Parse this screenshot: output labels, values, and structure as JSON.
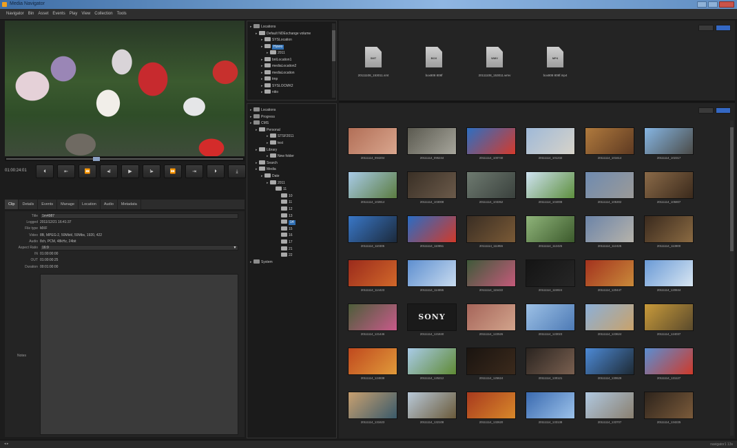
{
  "window": {
    "title": "Media Navigator"
  },
  "menu": [
    "Navigator",
    "Bin",
    "Asset",
    "Events",
    "Play",
    "View",
    "Collection",
    "Tools"
  ],
  "player": {
    "timecode": "01:00:24:01",
    "transport_buttons": [
      {
        "name": "go-to-start",
        "icon": "⏴"
      },
      {
        "name": "prev-marker",
        "icon": "⇤"
      },
      {
        "name": "rewind",
        "icon": "⏪"
      },
      {
        "name": "step-back",
        "icon": "◂I"
      },
      {
        "name": "play",
        "icon": "▶"
      },
      {
        "name": "step-forward",
        "icon": "I▸"
      },
      {
        "name": "fast-forward",
        "icon": "⏩"
      },
      {
        "name": "next-marker",
        "icon": "⇥"
      },
      {
        "name": "go-to-end",
        "icon": "⏵"
      },
      {
        "name": "export",
        "icon": "⤓"
      }
    ]
  },
  "tabs": [
    "Clip",
    "Details",
    "Events",
    "Manage",
    "Location",
    "Audio",
    "Metadata"
  ],
  "metadata": {
    "rows": [
      {
        "label": "Title",
        "value": "1m4987"
      },
      {
        "label": "Logged",
        "value": "2011/12/21 16:41:37"
      },
      {
        "label": "File type",
        "value": "MXF"
      },
      {
        "label": "Video",
        "value": "8B, MPEG-2, 50Mbit/, 59Mbs, 1920, 422"
      },
      {
        "label": "Audio",
        "value": "8ch, PCM, 48kHz, 24bit"
      },
      {
        "label": "Aspect Ratio",
        "value": "16:9"
      },
      {
        "label": "IN",
        "value": "01:00:00:00"
      },
      {
        "label": "OUT",
        "value": "01:00:00:25"
      },
      {
        "label": "Duration",
        "value": "00:01:00:00"
      }
    ],
    "notes_label": "Notes"
  },
  "tree_top": {
    "nodes": [
      {
        "label": "Locations",
        "indent": 0
      },
      {
        "label": "Default NDExchange volume",
        "indent": 1
      },
      {
        "label": "SYSLocation",
        "indent": 2
      },
      {
        "label": "Hzero",
        "indent": 2,
        "selected": true
      },
      {
        "label": "2011",
        "indent": 3
      },
      {
        "label": "bnlLocation1",
        "indent": 2
      },
      {
        "label": "mediaLocation2",
        "indent": 2
      },
      {
        "label": "mediaLocation",
        "indent": 2
      },
      {
        "label": "tmp",
        "indent": 2
      },
      {
        "label": "SYSLOCMK2",
        "indent": 2
      },
      {
        "label": "nitio",
        "indent": 2
      }
    ]
  },
  "tree_bottom": {
    "nodes": [
      {
        "label": "Locations",
        "indent": 0
      },
      {
        "label": "Progress",
        "indent": 0
      },
      {
        "label": "CMS",
        "indent": 0
      },
      {
        "label": "Personal",
        "indent": 1
      },
      {
        "label": "STSF2011",
        "indent": 3
      },
      {
        "label": "test",
        "indent": 3
      },
      {
        "label": "Library",
        "indent": 1
      },
      {
        "label": "New folder",
        "indent": 3
      },
      {
        "label": "Search",
        "indent": 1
      },
      {
        "label": "Media",
        "indent": 1
      },
      {
        "label": "Date",
        "indent": 2
      },
      {
        "label": "2011",
        "indent": 3
      },
      {
        "label": "11",
        "indent": 4
      },
      {
        "label": "10",
        "indent": 5
      },
      {
        "label": "11",
        "indent": 5
      },
      {
        "label": "12",
        "indent": 5
      },
      {
        "label": "13",
        "indent": 5
      },
      {
        "label": "14",
        "indent": 5,
        "selected": true
      },
      {
        "label": "15",
        "indent": 5
      },
      {
        "label": "16",
        "indent": 5
      },
      {
        "label": "17",
        "indent": 5
      },
      {
        "label": "21",
        "indent": 5
      },
      {
        "label": "22",
        "indent": 5
      },
      {
        "label": "System",
        "indent": 0
      }
    ]
  },
  "files": [
    {
      "ext": "SMT",
      "name": "20111108_153011.smt"
    },
    {
      "ext": "BOX",
      "name": "box808 808f"
    },
    {
      "ext": "WMV",
      "name": "20111108_153011.wmv"
    },
    {
      "ext": "MP4",
      "name": "box808 808f.mp4"
    }
  ],
  "clips": [
    {
      "name": "20111114_094204",
      "colors": [
        "#b26f57",
        "#d9a68e"
      ]
    },
    {
      "name": "20111114_095244",
      "colors": [
        "#5b5a50",
        "#a6a59b"
      ]
    },
    {
      "name": "20111114_100740",
      "colors": [
        "#2d6fc2",
        "#d43a2c"
      ]
    },
    {
      "name": "20111114_101232",
      "colors": [
        "#9fb9d8",
        "#d7d3c9"
      ]
    },
    {
      "name": "20111114_101614",
      "colors": [
        "#b07a3d",
        "#5e3a22"
      ]
    },
    {
      "name": "20111114_102317",
      "colors": [
        "#86b6e3",
        "#4b4b48"
      ]
    },
    {
      "name": "20111114_102814",
      "colors": [
        "#a8cbe8",
        "#5b7c40"
      ]
    },
    {
      "name": "20111114_103008",
      "colors": [
        "#3a3026",
        "#6b5a4a"
      ]
    },
    {
      "name": "20111114_103352",
      "colors": [
        "#6e7a70",
        "#3a413d"
      ]
    },
    {
      "name": "20111114_104008",
      "colors": [
        "#cfe3f2",
        "#5d8f3d"
      ]
    },
    {
      "name": "20111114_105302",
      "colors": [
        "#6f8bb0",
        "#9b9a98"
      ]
    },
    {
      "name": "20111114_105807",
      "colors": [
        "#8a6a48",
        "#3b2a1c"
      ]
    },
    {
      "name": "20111114_110305",
      "colors": [
        "#3977c7",
        "#1c2a3c"
      ]
    },
    {
      "name": "20111114_110851",
      "colors": [
        "#2a6cc4",
        "#d13a2a"
      ]
    },
    {
      "name": "20111114_111956",
      "colors": [
        "#3a2e24",
        "#7a5a36"
      ]
    },
    {
      "name": "20111114_112425",
      "colors": [
        "#8fb47a",
        "#3c5a2c"
      ]
    },
    {
      "name": "20111114_112425",
      "colors": [
        "#6c84a8",
        "#b6b3ab"
      ]
    },
    {
      "name": "20111114_113800",
      "colors": [
        "#3a2a1e",
        "#8a6a42"
      ]
    },
    {
      "name": "20111114_114423",
      "colors": [
        "#9b2b1c",
        "#d1682a"
      ]
    },
    {
      "name": "20111114_114655",
      "colors": [
        "#5e8fd0",
        "#c8dbef"
      ]
    },
    {
      "name": "20111114_115422",
      "colors": [
        "#3f5a3a",
        "#c45a7a"
      ]
    },
    {
      "name": "20111114_115924",
      "colors": [
        "#141414",
        "#262626"
      ]
    },
    {
      "name": "20111114_120447",
      "colors": [
        "#a3321e",
        "#c98a3a"
      ]
    },
    {
      "name": "20111114_120844",
      "colors": [
        "#6a9ad6",
        "#d8e6f2"
      ]
    },
    {
      "name": "20111114_121446",
      "colors": [
        "#4d5e3a",
        "#c85a8a"
      ]
    },
    {
      "name": "20111114_121840",
      "colors": [
        "#1a1a1a",
        "#1a1a1a"
      ],
      "text": "SONY"
    },
    {
      "name": "20111114_122526",
      "colors": [
        "#a6655a",
        "#d2a48c"
      ]
    },
    {
      "name": "20111114_123023",
      "colors": [
        "#9dc1e6",
        "#4d7ab5"
      ]
    },
    {
      "name": "20111114_123624",
      "colors": [
        "#8cb0d8",
        "#c9a26a"
      ]
    },
    {
      "name": "20111114_124037",
      "colors": [
        "#c89a3a",
        "#5a4a2c"
      ]
    },
    {
      "name": "20111114_124838",
      "colors": [
        "#c0491e",
        "#e09a3a"
      ]
    },
    {
      "name": "20111114_125212",
      "colors": [
        "#a9cbe8",
        "#5f8a34"
      ]
    },
    {
      "name": "20111114_125624",
      "colors": [
        "#1a1410",
        "#3b2a1c"
      ]
    },
    {
      "name": "20111114_130121",
      "colors": [
        "#2a2420",
        "#7a6050"
      ]
    },
    {
      "name": "20111114_130629",
      "colors": [
        "#4d8ad6",
        "#1e2a34"
      ]
    },
    {
      "name": "20111114_131127",
      "colors": [
        "#5a8ed2",
        "#cf3a2a"
      ]
    },
    {
      "name": "20111114_131623",
      "colors": [
        "#c8a070",
        "#3a5a6a"
      ]
    },
    {
      "name": "20111114_132108",
      "colors": [
        "#b8c8d8",
        "#6a5a3a"
      ]
    },
    {
      "name": "20111114_132620",
      "colors": [
        "#a83a1e",
        "#d8882a"
      ]
    },
    {
      "name": "20111114_133138",
      "colors": [
        "#3a6ab0",
        "#9cc2ea"
      ]
    },
    {
      "name": "20111114_133707",
      "colors": [
        "#b0c8e0",
        "#8a8070"
      ]
    },
    {
      "name": "20111114_134225",
      "colors": [
        "#2e241c",
        "#7a5a3a"
      ]
    }
  ],
  "status": {
    "left": "◂ ▸",
    "right": "navigator1 13s"
  }
}
